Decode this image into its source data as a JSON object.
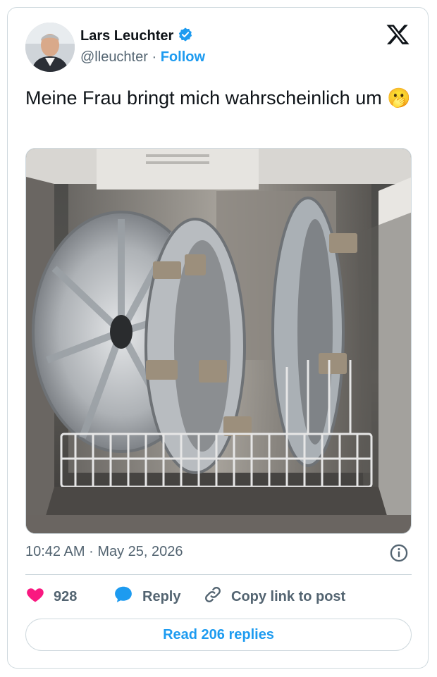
{
  "author": {
    "name": "Lars Leuchter",
    "handle": "@lleuchter",
    "separator": "·",
    "follow_label": "Follow",
    "verified": true
  },
  "tweet": {
    "text": "Meine Frau bringt mich wahrscheinlich um",
    "emoji": "🫢"
  },
  "meta": {
    "time": "10:42 AM",
    "separator": "·",
    "date": "May 25, 2026"
  },
  "actions": {
    "likes": "928",
    "reply_label": "Reply",
    "copy_label": "Copy link to post"
  },
  "footer": {
    "read_replies_label": "Read 206 replies"
  },
  "colors": {
    "accent": "#1d9bf0",
    "like": "#f91880",
    "text": "#0f1419",
    "muted": "#536471",
    "border": "#cfd9de"
  },
  "icons": [
    "verified-badge-icon",
    "x-logo-icon",
    "info-icon",
    "heart-icon",
    "reply-bubble-icon",
    "link-icon"
  ]
}
